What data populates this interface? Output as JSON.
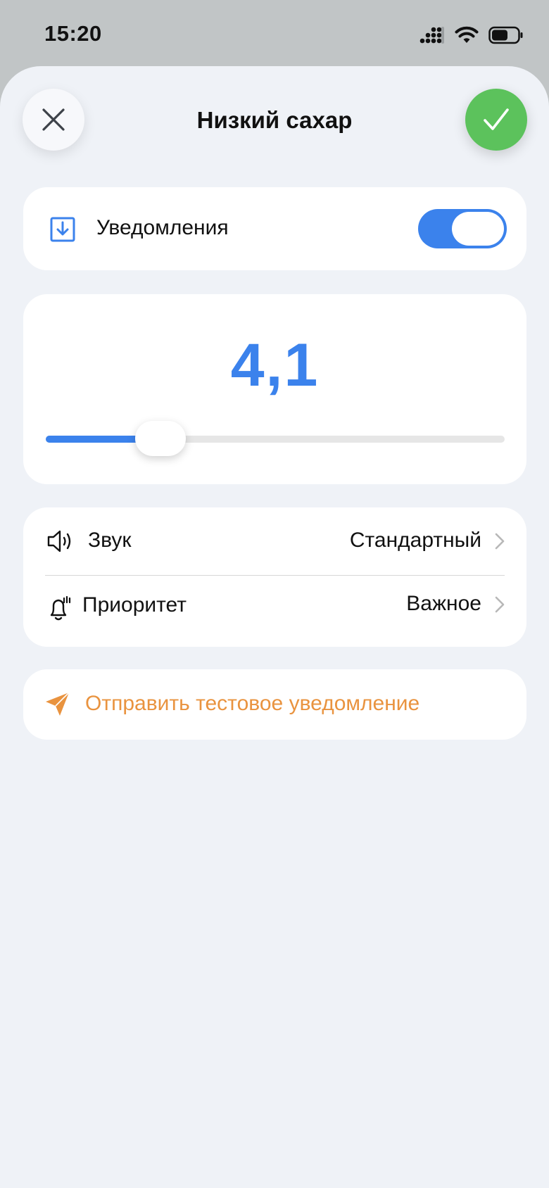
{
  "status_bar": {
    "time": "15:20",
    "icons": [
      "signal-icon",
      "wifi-icon",
      "battery-icon"
    ]
  },
  "header": {
    "title": "Низкий сахар",
    "close_icon": "close-icon",
    "confirm_icon": "checkmark-icon"
  },
  "notifications": {
    "label": "Уведомления",
    "icon": "download-box-icon",
    "enabled": true
  },
  "threshold": {
    "value_text": "4,1",
    "slider_fraction": 0.25
  },
  "settings": {
    "rows": [
      {
        "label": "Звук",
        "value": "Стандартный",
        "icon": "speaker-icon"
      },
      {
        "label": "Приоритет",
        "value": "Важное",
        "icon": "bell-ringing-icon"
      }
    ]
  },
  "test_action": {
    "label": "Отправить тестовое уведомление",
    "icon": "send-icon"
  },
  "colors": {
    "accent_blue": "#3b82ec",
    "confirm_green": "#5cc25c",
    "action_orange": "#e9933f",
    "sheet_background": "#eff2f7"
  }
}
